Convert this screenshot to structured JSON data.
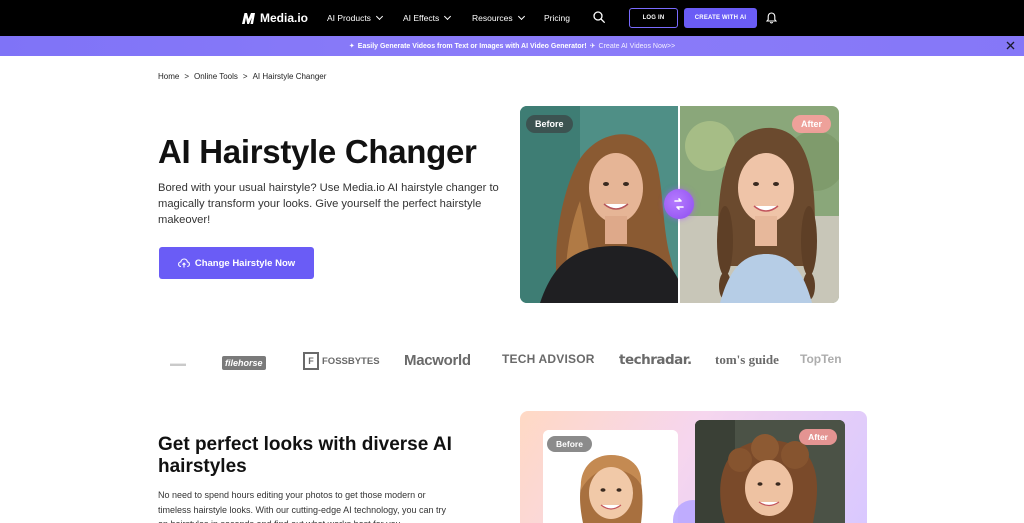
{
  "nav": {
    "brand": "Media.io",
    "items": [
      "AI Products",
      "AI Effects",
      "Resources",
      "Pricing"
    ],
    "login_label": "LOG IN",
    "create_label": "CREATE WITH AI"
  },
  "banner": {
    "text": "Easily Generate Videos from Text or Images with AI Video Generator!",
    "cta": "Create AI Videos Now>>"
  },
  "breadcrumb": [
    "Home",
    ">",
    "Online Tools",
    ">",
    "AI Hairstyle Changer"
  ],
  "hero": {
    "title": "AI Hairstyle Changer",
    "description": "Bored with your usual hairstyle? Use Media.io AI hairstyle changer to magically transform your looks. Give yourself the perfect hairstyle makeover!",
    "button_label": "Change Hairstyle Now",
    "before_label": "Before",
    "after_label": "After"
  },
  "press": [
    "filehorse",
    "FOSSBYTES",
    "Macworld",
    "TECH ADVISOR",
    "techradar.",
    "tom's guide",
    "TopTen"
  ],
  "section2": {
    "title": "Get perfect looks with diverse AI hairstyles",
    "description": "No need to spend hours editing your photos to get those modern or timeless hairstyle looks. With our cutting-edge AI technology, you can try on hairstyles in seconds and find out what works best for you.",
    "before_label": "Before",
    "after_label": "After"
  },
  "colors": {
    "accent": "#6a5cf6",
    "banner": "#8577f8",
    "nav_bg": "#000000"
  },
  "icons": [
    "media-io-logo-icon",
    "search-icon",
    "bell-icon",
    "close-icon",
    "cloud-upload-icon",
    "swap-icon"
  ]
}
